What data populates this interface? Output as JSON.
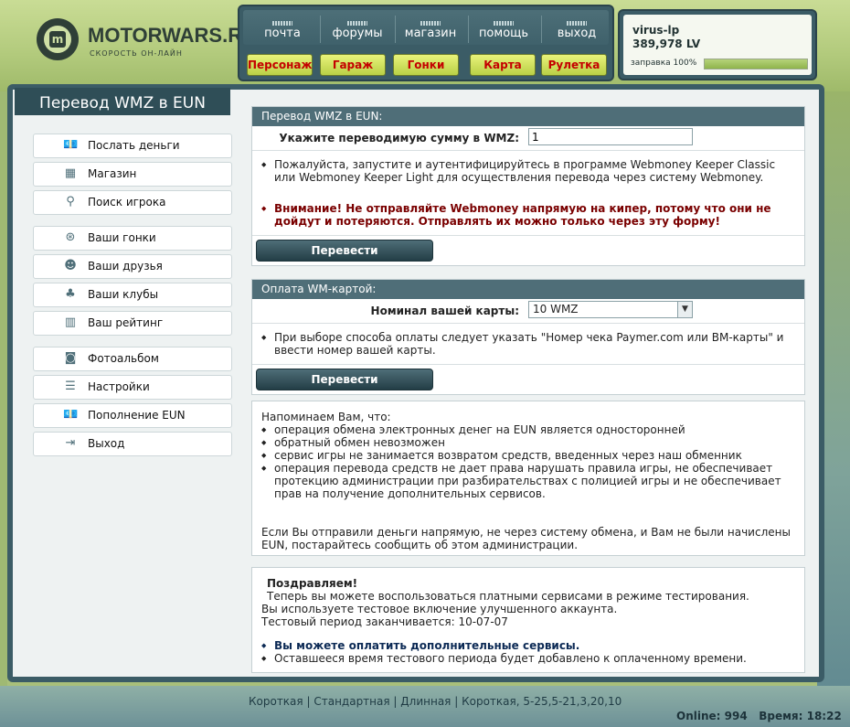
{
  "logo": {
    "title": "MOTORWARS.RU",
    "subtitle": "СКОРОСТЬ ОН-ЛАЙН",
    "mark": "m"
  },
  "nav": {
    "links": [
      "почта",
      "форумы",
      "магазин",
      "помощь",
      "выход"
    ],
    "buttons": [
      "Персонаж",
      "Гараж",
      "Гонки",
      "Карта",
      "Рулетка"
    ]
  },
  "user": {
    "name": "virus-lp",
    "money": "389,978 LV",
    "fuel_label": "заправка 100%",
    "fuel_fraction": 1.0
  },
  "page_title": "Перевод WMZ в EUN",
  "menu": {
    "group1": [
      {
        "label": "Послать деньги",
        "icon": "money-icon"
      },
      {
        "label": "Магазин",
        "icon": "shop-icon"
      },
      {
        "label": "Поиск игрока",
        "icon": "search-icon"
      }
    ],
    "group2": [
      {
        "label": "Ваши гонки",
        "icon": "steering-wheel-icon"
      },
      {
        "label": "Ваши друзья",
        "icon": "friends-icon"
      },
      {
        "label": "Ваши клубы",
        "icon": "clubs-icon"
      },
      {
        "label": "Ваш рейтинг",
        "icon": "rating-icon"
      }
    ],
    "group3": [
      {
        "label": "Фотоальбом",
        "icon": "camera-icon"
      },
      {
        "label": "Настройки",
        "icon": "settings-icon"
      },
      {
        "label": "Пополнение EUN",
        "icon": "money-icon"
      },
      {
        "label": "Выход",
        "icon": "exit-icon"
      }
    ]
  },
  "transfer": {
    "header": "Перевод WMZ в EUN:",
    "amount_label": "Укажите переводимую сумму в WMZ:",
    "amount_value": "1",
    "info": "Пожалуйста, запустите и аутентифицируйтесь в программе Webmoney Keeper Classic или Webmoney Keeper Light для осуществления перевода через систему Webmoney.",
    "warning": "Внимание! Не отправляйте Webmoney напрямую на кипер, потому что они не дойдут и потеряются. Отправлять их можно только через эту форму!",
    "button": "Перевести"
  },
  "card": {
    "header": "Оплата WM-картой:",
    "nominal_label": "Номинал вашей карты:",
    "nominal_value": "10 WMZ",
    "info": "При выборе способа оплаты следует указать \"Номер чека Paymer.com или ВМ-карты\" и ввести номер вашей карты.",
    "button": "Перевести"
  },
  "reminder": {
    "intro": "Напоминаем Вам, что:",
    "items": [
      "операция обмена электронных денег на EUN является односторонней",
      "обратный обмен невозможен",
      "сервис игры не занимается возвратом средств, введенных через наш обменник",
      "операция перевода средств не дает права нарушать правила игры, не обеспечивает протекцию администрации при разбирательствах с полицией игры и не обеспечивает прав на получение дополнительных сервисов."
    ],
    "footer": "Если Вы отправили деньги напрямую, не через систему обмена, и Вам не были начислены EUN, постарайтесь сообщить об этом администрации."
  },
  "congrats": {
    "title": "Поздравляем!",
    "line1": "Теперь вы можете воспользоваться платными сервисами в режиме тестирования.",
    "line2": "Вы используете тестовое включение улучшенного аккаунта.",
    "line3": "Тестовый период заканчивается: 10-07-07",
    "bullet1": "Вы можете оплатить дополнительные сервисы.",
    "bullet2": "Оставшееся время тестового периода будет добавлено к оплаченному времени."
  },
  "footer": {
    "links": [
      "Короткая",
      "Стандартная",
      "Длинная",
      "Короткая, 5-25,5-21,3,20,10"
    ],
    "separator": "|",
    "online": "Online: 994",
    "time": "Время: 18:22"
  }
}
